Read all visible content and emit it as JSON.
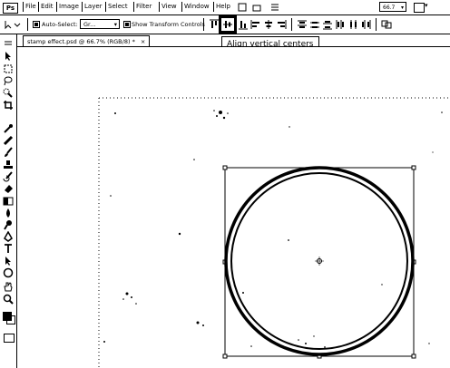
{
  "menubar": {
    "logo": "Ps",
    "items": [
      "File",
      "Edit",
      "Image",
      "Layer",
      "Select",
      "Filter",
      "View",
      "Window",
      "Help"
    ],
    "zoom_value": "66.7",
    "zoom_arrow": "▾",
    "screen_arrow": "▾"
  },
  "options": {
    "tool_icon": "move-tool-icon",
    "auto_select_label": "Auto-Select:",
    "auto_select_value": "Gr...",
    "dropdown_arrow": "▾",
    "transform_label": "Show Transform Controls",
    "align_buttons": [
      "align-top-edges-icon",
      "align-vertical-centers-icon",
      "align-bottom-edges-icon",
      "align-left-edges-icon",
      "align-horizontal-centers-icon",
      "align-right-edges-icon",
      "distribute-top-icon",
      "distribute-vertical-centers-icon",
      "distribute-bottom-icon",
      "distribute-left-icon",
      "distribute-horizontal-centers-icon",
      "distribute-right-icon",
      "auto-align-icon"
    ]
  },
  "tooltip": {
    "text": "Align vertical centers"
  },
  "document": {
    "tab_title": "stamp effect.psd @ 66.7% (RGB/8) *",
    "close_glyph": "×"
  },
  "tools": [
    "move-tool-icon",
    "marquee-tool-icon",
    "lasso-tool-icon",
    "quick-select-tool-icon",
    "crop-tool-icon",
    "eyedropper-tool-icon",
    "healing-brush-tool-icon",
    "brush-tool-icon",
    "clone-stamp-tool-icon",
    "history-brush-tool-icon",
    "eraser-tool-icon",
    "gradient-tool-icon",
    "blur-tool-icon",
    "dodge-tool-icon",
    "pen-tool-icon",
    "type-tool-icon",
    "path-select-tool-icon",
    "shape-tool-icon",
    "hand-tool-icon",
    "zoom-tool-icon"
  ]
}
